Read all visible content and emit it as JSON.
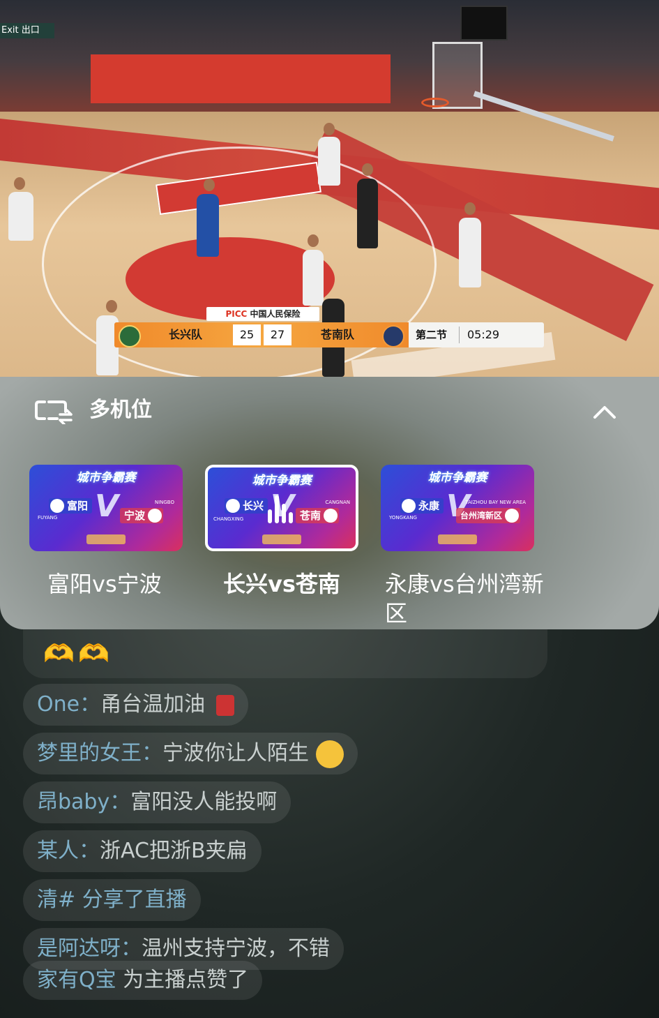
{
  "video": {
    "exit_sign": "Exit 出口",
    "sponsor": "PICC 中国人民保险",
    "sponsor_prefix": "PICC",
    "sponsor_name": "中国人民保险",
    "scoreboard": {
      "home_team": "长兴队",
      "home_score": "25",
      "away_score": "27",
      "away_team": "苍南队",
      "period": "第二节",
      "clock": "05:29"
    }
  },
  "panel": {
    "title": "多机位",
    "collapse_icon": "chevron-up-icon",
    "cameras": [
      {
        "label": "富阳vs宁波",
        "selected": false,
        "banner": "城市争霸赛",
        "left_team": "富阳",
        "right_team": "宁波",
        "left_en": "FUYANG",
        "right_en": "NINGBO"
      },
      {
        "label": "长兴vs苍南",
        "selected": true,
        "banner": "城市争霸赛",
        "left_team": "长兴",
        "right_team": "苍南",
        "left_en": "CHANGXING",
        "right_en": "CANGNAN"
      },
      {
        "label": "永康vs台州湾新区",
        "selected": false,
        "banner": "城市争霸赛",
        "left_team": "永康",
        "right_team": "台州湾新区",
        "left_en": "YONGKANG",
        "right_en": "TAIZHOU BAY NEW AREA"
      }
    ]
  },
  "chat": {
    "messages": [
      {
        "user": "One：",
        "text": "甬台温加油"
      },
      {
        "user": "梦里的女王：",
        "text": "宁波你让人陌生"
      },
      {
        "user": "昂baby：",
        "text": "富阳没人能投啊"
      },
      {
        "user": "某人：",
        "text": "浙AC把浙B夹扁"
      },
      {
        "user": "清#",
        "text": "分享了直播"
      },
      {
        "user": "是阿达呀：",
        "text": "温州支持宁波，不错"
      },
      {
        "user": "家有Q宝",
        "text": "为主播点赞了"
      }
    ]
  },
  "colors": {
    "score_orange": "#f5a640",
    "panel_bg": "#7d8580",
    "username": "#7fb0c9"
  }
}
